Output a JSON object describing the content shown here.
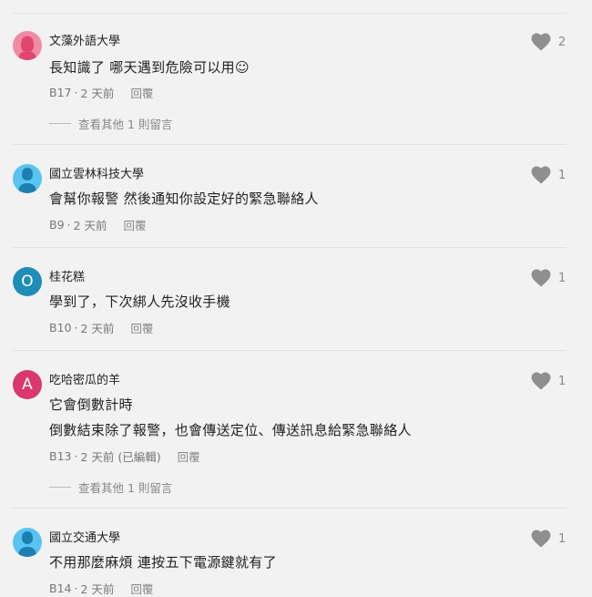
{
  "colors": {
    "background": "#f2f2f2",
    "heart": "#8f8f8f",
    "avatar_pink": "#f18aa5",
    "avatar_blue": "#59c4f0",
    "avatar_teal": "#1e8db8",
    "avatar_red": "#d8386f"
  },
  "comments": [
    {
      "author": "文藻外語大學",
      "avatar_icon": "female-user-icon",
      "lines": [
        "長知識了 哪天遇到危險可以用☺"
      ],
      "floor": "B17",
      "time": "2 天前",
      "edited": "",
      "reply": "回覆",
      "likes": "2",
      "more": "查看其他 1 則留言"
    },
    {
      "author": "國立雲林科技大學",
      "avatar_icon": "male-user-icon",
      "lines": [
        "會幫你報警 然後通知你設定好的緊急聯絡人"
      ],
      "floor": "B9",
      "time": "2 天前",
      "edited": "",
      "reply": "回覆",
      "likes": "1",
      "more": ""
    },
    {
      "author": "桂花糕",
      "avatar_letter": "O",
      "lines": [
        "學到了，下次綁人先沒收手機"
      ],
      "floor": "B10",
      "time": "2 天前",
      "edited": "",
      "reply": "回覆",
      "likes": "1",
      "more": ""
    },
    {
      "author": "吃哈密瓜的羊",
      "avatar_letter": "A",
      "lines": [
        "它會倒數計時",
        "倒數結束除了報警，也會傳送定位、傳送訊息給緊急聯絡人"
      ],
      "floor": "B13",
      "time": "2 天前",
      "edited": "(已編輯)",
      "reply": "回覆",
      "likes": "1",
      "more": "查看其他 1 則留言"
    },
    {
      "author": "國立交通大學",
      "avatar_icon": "male-user-icon",
      "lines": [
        "不用那麼麻煩 連按五下電源鍵就有了"
      ],
      "floor": "B14",
      "time": "2 天前",
      "edited": "",
      "reply": "回覆",
      "likes": "1",
      "more": ""
    }
  ]
}
